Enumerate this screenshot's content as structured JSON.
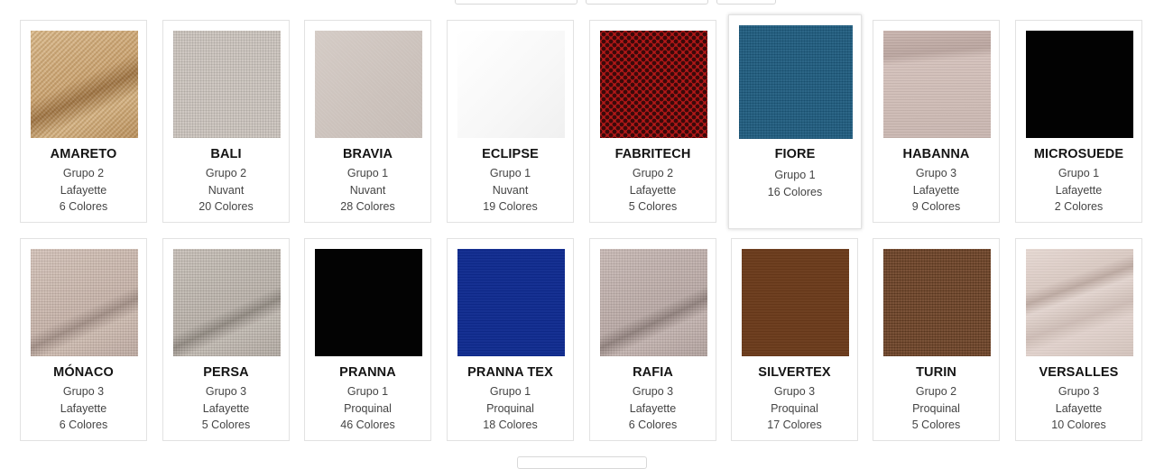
{
  "fabrics": [
    {
      "name": "AMARETO",
      "group": "Grupo 2",
      "brand": "Lafayette",
      "colors": "6 Colores",
      "texture": "tan-woven"
    },
    {
      "name": "BALI",
      "group": "Grupo 2",
      "brand": "Nuvant",
      "colors": "20 Colores",
      "texture": "light-grey-woven"
    },
    {
      "name": "BRAVIA",
      "group": "Grupo 1",
      "brand": "Nuvant",
      "colors": "28 Colores",
      "texture": "beige-smooth"
    },
    {
      "name": "ECLIPSE",
      "group": "Grupo 1",
      "brand": "Nuvant",
      "colors": "19 Colores",
      "texture": "white-smooth"
    },
    {
      "name": "FABRITECH",
      "group": "Grupo 2",
      "brand": "Lafayette",
      "colors": "5 Colores",
      "texture": "red-mesh"
    },
    {
      "name": "FIORE",
      "group": "Grupo 1",
      "colors": "16 Colores",
      "texture": "teal-blue-woven"
    },
    {
      "name": "HABANNA",
      "group": "Grupo 3",
      "brand": "Lafayette",
      "colors": "9 Colores",
      "texture": "pink-beige-woven"
    },
    {
      "name": "MICROSUEDE",
      "group": "Grupo 1",
      "brand": "Lafayette",
      "colors": "2 Colores",
      "texture": "black"
    },
    {
      "name": "MÓNACO",
      "group": "Grupo 3",
      "brand": "Lafayette",
      "colors": "6 Colores",
      "texture": "pink-beige-woven"
    },
    {
      "name": "PERSA",
      "group": "Grupo 3",
      "brand": "Lafayette",
      "colors": "5 Colores",
      "texture": "grey-woven"
    },
    {
      "name": "PRANNA",
      "group": "Grupo 1",
      "brand": "Proquinal",
      "colors": "46 Colores",
      "texture": "black"
    },
    {
      "name": "PRANNA TEX",
      "group": "Grupo 1",
      "brand": "Proquinal",
      "colors": "18 Colores",
      "texture": "royal-blue"
    },
    {
      "name": "RAFIA",
      "group": "Grupo 3",
      "brand": "Lafayette",
      "colors": "6 Colores",
      "texture": "mauve-woven"
    },
    {
      "name": "SILVERTEX",
      "group": "Grupo 3",
      "brand": "Proquinal",
      "colors": "17 Colores",
      "texture": "brown"
    },
    {
      "name": "TURIN",
      "group": "Grupo 2",
      "brand": "Proquinal",
      "colors": "5 Colores",
      "texture": "brown-woven"
    },
    {
      "name": "VERSALLES",
      "group": "Grupo 3",
      "brand": "Lafayette",
      "colors": "10 Colores",
      "texture": "pale-pink-folded"
    }
  ],
  "colors": {
    "card_border": "#e2e2e2",
    "name_text": "#141414",
    "detail_text": "#444444",
    "background": "#ffffff"
  }
}
